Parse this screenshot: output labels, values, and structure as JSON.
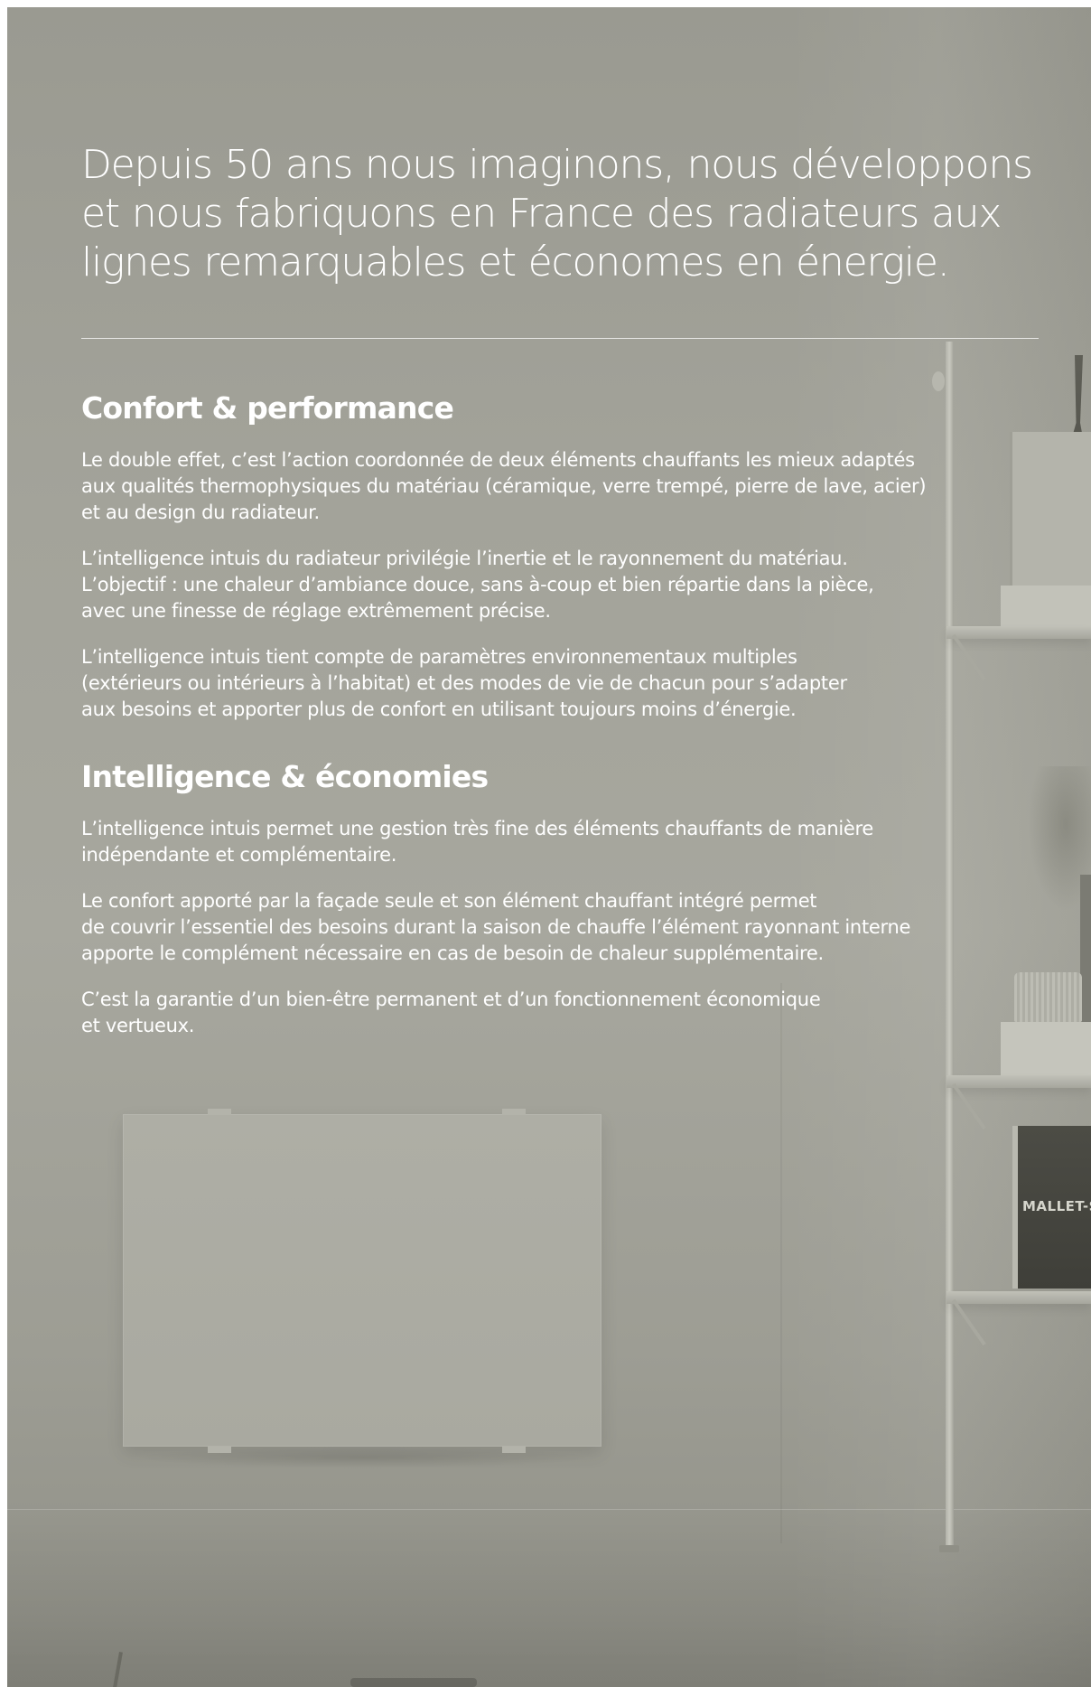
{
  "intro": {
    "line1": "Depuis 50 ans nous imaginons, nous développons",
    "line2": "et nous fabriquons en France des radiateurs aux",
    "line3": "lignes remarquables et économes en énergie."
  },
  "sections": [
    {
      "title": "Confort & performance",
      "paragraphs": [
        {
          "lines": [
            "Le double effet, c’est l’action coordonnée de deux éléments chauffants les mieux adaptés",
            "aux qualités thermophysiques du matériau (céramique, verre trempé, pierre de lave, acier)",
            "et au design du radiateur."
          ]
        },
        {
          "lines": [
            "L’intelligence intuis du radiateur privilégie l’inertie et le rayonnement du matériau.",
            "L’objectif : une chaleur d’ambiance douce, sans à-coup et bien répartie dans la pièce,",
            "avec une finesse de réglage extrêmement précise."
          ]
        },
        {
          "lines": [
            "L’intelligence intuis tient compte de paramètres environnementaux multiples",
            "(extérieurs ou intérieurs à l’habitat) et des modes de vie de chacun pour s’adapter",
            "aux besoins et apporter plus de confort en utilisant toujours moins d’énergie."
          ]
        }
      ]
    },
    {
      "title": "Intelligence & économies",
      "paragraphs": [
        {
          "lines": [
            "L’intelligence intuis permet une gestion très fine des éléments chauffants de manière",
            "indépendante et complémentaire."
          ]
        },
        {
          "lines": [
            "Le confort apporté par la façade seule et son élément chauffant intégré permet",
            "de couvrir l’essentiel des besoins durant la saison de chauffe l’élément rayonnant interne",
            "apporte le complément nécessaire en cas de besoin de chaleur supplémentaire."
          ]
        },
        {
          "lines": [
            "C’est la garantie d’un bien-être permanent et d’un fonctionnement économique",
            "et vertueux."
          ]
        }
      ]
    }
  ],
  "photo": {
    "book_title": "MALLET-S"
  },
  "colors": {
    "background": "#a3a39a",
    "text": "#ffffff"
  }
}
